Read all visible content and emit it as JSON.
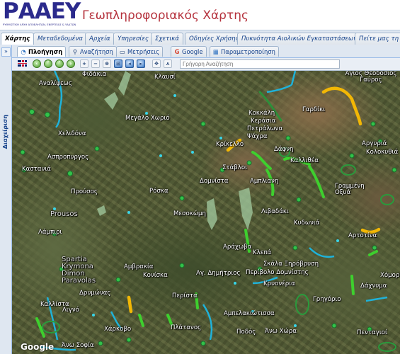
{
  "app": {
    "logo_text": "ΡΑΑΕΥ",
    "logo_subtitle": "ΡΥΘΜΙΣΤΙΚΗ ΑΡΧΗ ΑΠΟΒΛΗΤΩΝ, ΕΝΕΡΓΕΙΑΣ & ΥΔΑΤΩΝ",
    "title": "Γεωπληροφοριακός Χάρτης"
  },
  "tabs": [
    "Χάρτης",
    "Μεταδεδομένα",
    "Αρχεία",
    "Υπηρεσίες",
    "Σχετικά",
    "Οδηγίες Χρήσης",
    "Πυκνότητα Αιολικών Εγκαταστάσεων",
    "Πείτε μας τη γ"
  ],
  "left_panel": {
    "expand": "»",
    "label": "Διαχείριση"
  },
  "subtabs": [
    {
      "label": "Πλοήγηση",
      "icon": "navigation-icon"
    },
    {
      "label": "Αναζήτηση",
      "icon": "search-icon"
    },
    {
      "label": "Μετρήσεις",
      "icon": "ruler-icon"
    },
    {
      "label": "Google",
      "icon": "google-icon"
    },
    {
      "label": "Παραμετροποίηση",
      "icon": "settings-icon"
    }
  ],
  "toolbar": {
    "quick_search_placeholder": "Γρήγορη Αναζήτηση",
    "buttons": [
      "language-flag",
      "back",
      "forward",
      "up",
      "down",
      "zoom-in",
      "zoom-out",
      "zoom-box",
      "zoom-extent",
      "zoom-previous",
      "zoom-next",
      "pan",
      "measure"
    ]
  },
  "map": {
    "attribution": "Google",
    "labels": [
      "Φιδάκια",
      "Κλαυσί",
      "Άγιος Θεοδόσιος Γαύρος",
      "Αναλίψεως",
      "Μεγάλο Χωριό",
      "Κοκκάλη",
      "Κεράσια",
      "Πετράλωνα",
      "Ψάχρα",
      "Γαρδίκι",
      "Χελιδόνα",
      "Κρίκελλο",
      "Αργυριά",
      "Κολοκυθιά",
      "Ασπροπυργος",
      "Καστανιά",
      "Στάβλοι",
      "Δάφνη",
      "Δομνίστα",
      "Αμπλιανη",
      "Καλλιθέα",
      "Προύσος",
      "Ρόσκα",
      "Γραμμένη Οξυά",
      "Prousos",
      "Λιβαδάκι",
      "Μεσοκώμη",
      "Κυδωνιά",
      "Λάμπιρι",
      "Αρτοτίνα",
      "Αράχωβα",
      "Κλεπά",
      "Spartia Krymona Dimon Paravolas",
      "Αμβρακία",
      "Κονίσκα",
      "Αγ. Δημήτριος",
      "Περίβολο Δομνίστης",
      "Δρυμώνας",
      "Κρυονέρια",
      "Σκάλα Ξηρόβρυση",
      "Χόμορι",
      "Δάχνυμα",
      "Περίστα",
      "Λιγνό",
      "Γρηγόριο",
      "Αμπελακιώτισσα",
      "Χάρκοβο",
      "Πλάτανος",
      "Ποδός",
      "Άνω Χώρα",
      "Πενταγιοί",
      "Άνω Σοφία",
      "Καλλίστα"
    ]
  },
  "colors": {
    "brand": "#2b2a8c",
    "title_red": "#b5323d",
    "wind_green": "#3ecf2e",
    "wind_yellow": "#f2b705",
    "river_blue": "#1fb2d9"
  }
}
